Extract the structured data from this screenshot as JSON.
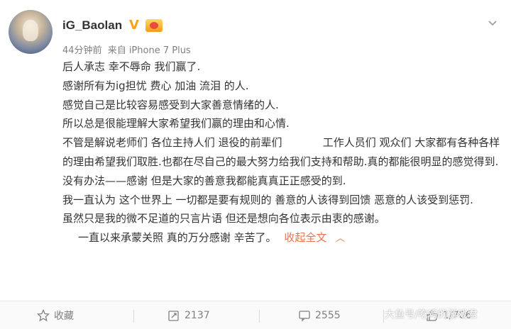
{
  "post": {
    "username": "iG_Baolan",
    "verified_icon": "verified-v-icon",
    "vip_icon": "vip-badge-icon",
    "time": "44分钟前",
    "source": "来自 iPhone 7 Plus",
    "lines": [
      "后人承志 幸不辱命 我们赢了.",
      "感谢所有为ig担忧 费心 加油 流泪 的人.",
      "感觉自己是比较容易感受到大家善意情绪的人.",
      "所以总是很能理解大家希望我们赢的理由和心情.",
      "不管是解说老师们 各位主持人们 退役的前辈们            工作人员们 观众们 大家都有各种各样的理由希望我们取胜.也都在尽自己的最大努力给我们支持和帮助.真的都能很明显的感觉得到.",
      "没有办法——感谢 但是大家的善意我都能真真正正感受的到.",
      "我一直认为 这个世界上 一切都是要有规则的 善意的人该得到回馈 恶意的人该受到惩罚.",
      "虽然只是我的微不足道的只言片语 但还是想向各位表示由衷的感谢。",
      "一直以来承蒙关照 真的万分感谢 辛苦了。"
    ],
    "collapse_label": "收起全文",
    "collapse_icon": "chevron-up-icon",
    "more_icon": "chevron-down-icon"
  },
  "actions": {
    "favorite_label": "收藏",
    "repost_count": "2137",
    "comment_count": "2555",
    "like_count": "1/706"
  },
  "watermark": "大鱼号/吃鸡的游戏君",
  "colors": {
    "accent": "#eb7350",
    "verified": "#f7a21a"
  }
}
